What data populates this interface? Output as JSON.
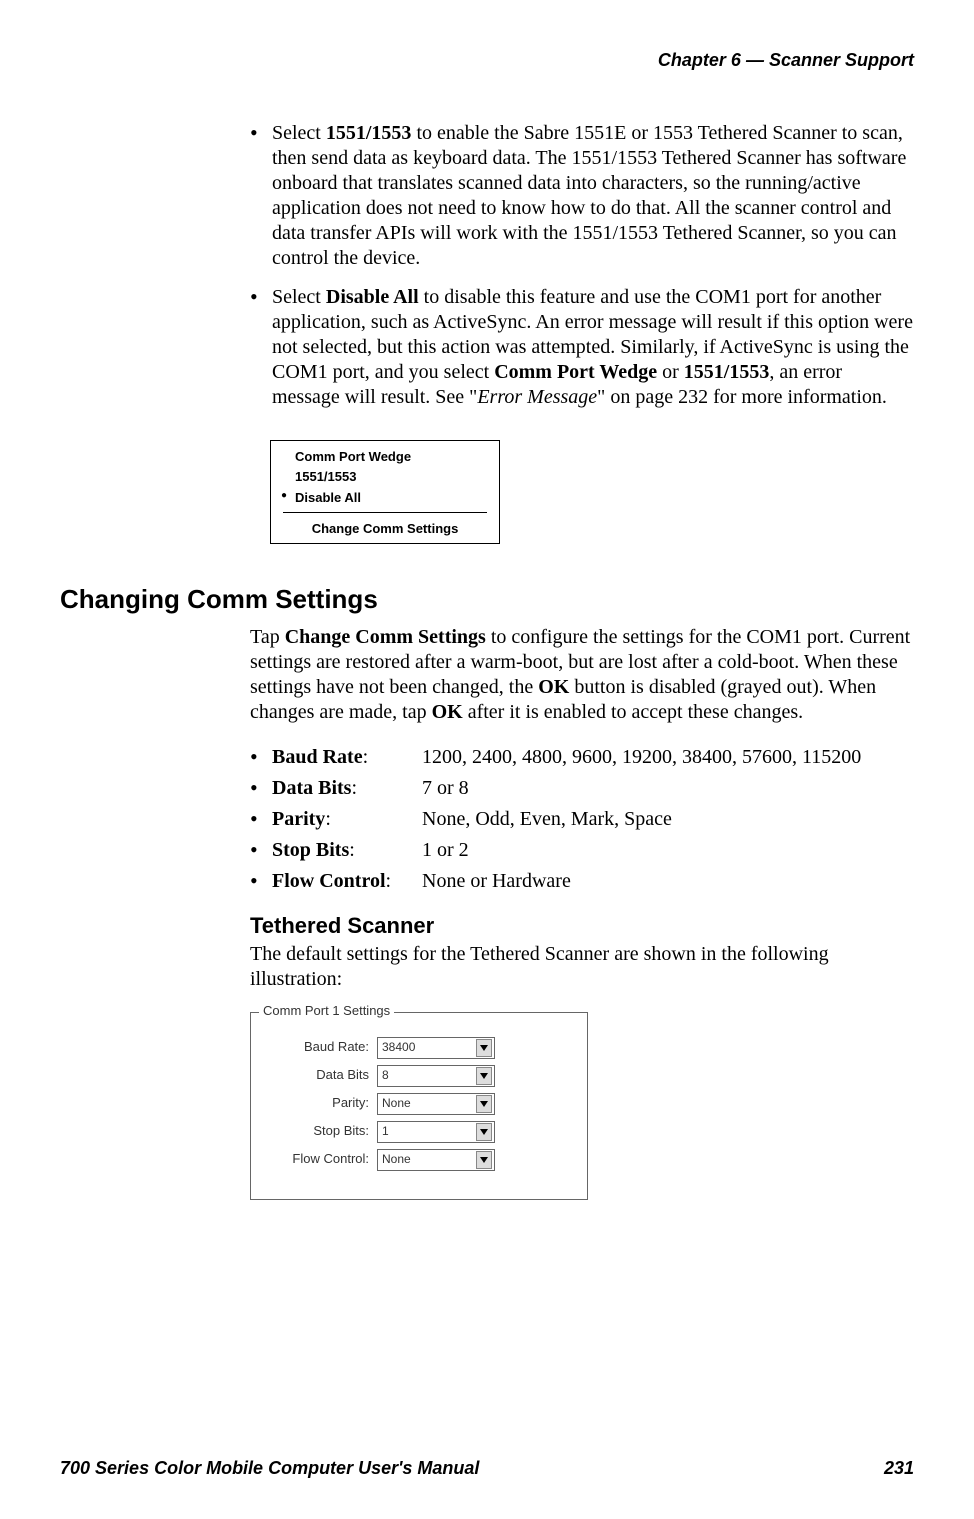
{
  "header": {
    "chapter_label": "Chapter",
    "chapter_num": "6",
    "sep": "—",
    "title": "Scanner Support"
  },
  "bullets": {
    "b1_prefix": "Select ",
    "b1_strong": "1551/1553",
    "b1_rest": " to enable the Sabre 1551E or 1553 Tethered Scanner to scan, then send data as keyboard data. The 1551/1553 Tethered Scanner has software onboard that translates scanned data into characters, so the running/active application does not need to know how to do that. All the scanner control and data transfer APIs will work with the 1551/1553 Tethered Scanner, so you can control the device.",
    "b2_prefix": "Select ",
    "b2_strong": "Disable All",
    "b2_mid1": " to disable this feature and use the COM1 port for another application, such as ActiveSync. An error message will result if this option were not selected, but this action was attempted. Similarly, if ActiveSync is using the COM1 port, and you select ",
    "b2_strong2": "Comm Port Wedge",
    "b2_mid2": " or ",
    "b2_strong3": "1551/1553",
    "b2_mid3": ", an error message will result. See \"",
    "b2_em": "Error Message",
    "b2_end": "\" on page 232 for more information."
  },
  "menu": {
    "item1": "Comm Port Wedge",
    "item2": "1551/1553",
    "item3": "Disable All",
    "bottom": "Change Comm Settings"
  },
  "section_heading": "Changing Comm Settings",
  "section_para": {
    "p1": "Tap ",
    "strong1": "Change Comm Settings",
    "p2": " to configure the settings for the COM1 port. Current settings are restored after a warm-boot, but are lost after a cold-boot. When these settings have not been changed, the ",
    "strong2": "OK",
    "p3": " button is disabled (grayed out). When changes are made, tap ",
    "strong3": "OK",
    "p4": " after it is enabled to accept these changes."
  },
  "settings": [
    {
      "label": "Baud Rate",
      "value": "1200, 2400, 4800, 9600, 19200, 38400, 57600, 115200"
    },
    {
      "label": "Data Bits",
      "value": "7 or 8"
    },
    {
      "label": "Parity",
      "value": "None, Odd, Even, Mark, Space"
    },
    {
      "label": "Stop Bits",
      "value": "1 or 2"
    },
    {
      "label": "Flow Control",
      "value": "None or Hardware"
    }
  ],
  "subsection_heading": "Tethered Scanner",
  "subsection_para": "The default settings for the Tethered Scanner are shown in the following illustration:",
  "dialog": {
    "legend": "Comm Port 1 Settings",
    "rows": [
      {
        "label": "Baud Rate:",
        "value": "38400"
      },
      {
        "label": "Data Bits",
        "value": "8"
      },
      {
        "label": "Parity:",
        "value": "None"
      },
      {
        "label": "Stop Bits:",
        "value": "1"
      },
      {
        "label": "Flow Control:",
        "value": "None"
      }
    ]
  },
  "footer": {
    "left": "700 Series Color Mobile Computer User's Manual",
    "right": "231"
  }
}
